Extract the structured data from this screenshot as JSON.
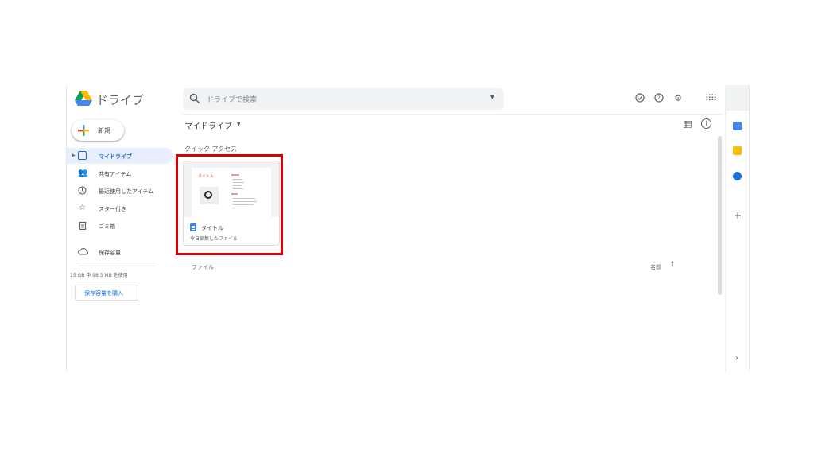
{
  "app": {
    "title": "ドライブ",
    "search_placeholder": "ドライブで検索",
    "search_options_icon": "caret-down-icon",
    "header_icons": [
      "offline-status-icon",
      "help-icon",
      "settings-icon",
      "apps-grid-icon"
    ]
  },
  "sidebar": {
    "new_label": "新規",
    "items": [
      {
        "label": "マイドライブ",
        "icon": "my-drive-icon",
        "active": true
      },
      {
        "label": "共有アイテム",
        "icon": "people-icon",
        "active": false
      },
      {
        "label": "最近使用したアイテム",
        "icon": "clock-icon",
        "active": false
      },
      {
        "label": "スター付き",
        "icon": "star-icon",
        "active": false
      },
      {
        "label": "ゴミ箱",
        "icon": "trash-icon",
        "active": false
      },
      {
        "label": "保存容量",
        "icon": "cloud-icon",
        "active": false
      }
    ],
    "storage_text": "15 GB 中 98.3 MB を使用",
    "buy_storage": "保存容量を購入"
  },
  "main": {
    "breadcrumb": "マイドライブ",
    "quick_access_label": "クイック アクセス",
    "quick_access": [
      {
        "name": "タイトル",
        "subtitle": "今日編集したファイル",
        "type": "google-docs",
        "thumbnail_title": "タイトル"
      }
    ],
    "files_label": "ファイル",
    "sort_label": "名前",
    "sort_direction_icon": "arrow-up-icon"
  },
  "right_panel": {
    "apps": [
      "calendar-icon",
      "keep-icon",
      "tasks-icon"
    ],
    "add_icon": "plus-icon",
    "collapse_icon": "chevron-right-icon"
  },
  "colors": {
    "accent": "#1a73e8",
    "active_nav_bg": "#e8f0fe",
    "highlight_border": "#d50000",
    "calendar": "#4285f4",
    "keep": "#fbbc04",
    "tasks": "#1a73e8"
  }
}
